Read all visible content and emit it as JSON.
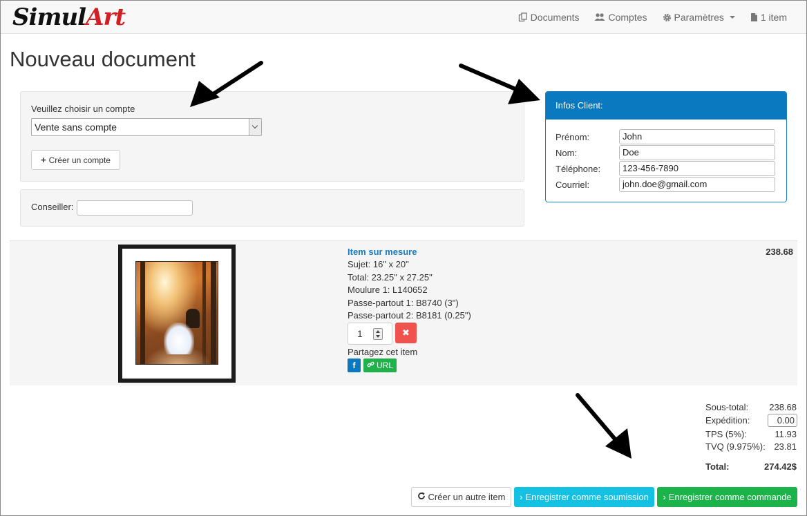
{
  "app": {
    "logo_part1": "Simul",
    "logo_part2": "Art"
  },
  "nav": {
    "documents": "Documents",
    "comptes": "Comptes",
    "parametres": "Paramètres",
    "cart": "1 item"
  },
  "page": {
    "title": "Nouveau document"
  },
  "account": {
    "label": "Veuillez choisir un compte",
    "selected": "Vente sans compte",
    "create_button": "Créer un compte"
  },
  "conseiller": {
    "label": "Conseiller:",
    "value": ""
  },
  "client": {
    "heading": "Infos Client:",
    "fields": [
      {
        "label": "Prénom:",
        "value": "John"
      },
      {
        "label": "Nom:",
        "value": "Doe"
      },
      {
        "label": "Téléphone:",
        "value": "123-456-7890"
      },
      {
        "label": "Courriel:",
        "value": "john.doe@gmail.com"
      }
    ]
  },
  "item": {
    "title": "Item sur mesure",
    "details": [
      "Sujet: 16\" x 20\"",
      "Total: 23.25\" x 27.25\"",
      "Moulure 1: L140652",
      "Passe-partout 1: B8740 (3\")",
      "Passe-partout 2: B8181 (0.25\")"
    ],
    "price": "238.68",
    "quantity": "1",
    "share_label": "Partagez cet item",
    "fb_label": "f",
    "url_label": "URL"
  },
  "totals": {
    "subtotal_label": "Sous-total:",
    "subtotal": "238.68",
    "shipping_label": "Expédition:",
    "shipping": "0.00",
    "tps_label": "TPS (5%):",
    "tps": "11.93",
    "tvq_label": "TVQ (9.975%):",
    "tvq": "23.81",
    "total_label": "Total:",
    "total": "274.42$"
  },
  "actions": {
    "new_item": "Créer un autre item",
    "save_quote": "Enregistrer comme soumission",
    "save_order": "Enregistrer comme commande"
  },
  "colors": {
    "primary": "#0b79c0",
    "info": "#15c1e3",
    "success": "#1db34b",
    "danger": "#f0524d",
    "logo_accent": "#d21f26"
  }
}
